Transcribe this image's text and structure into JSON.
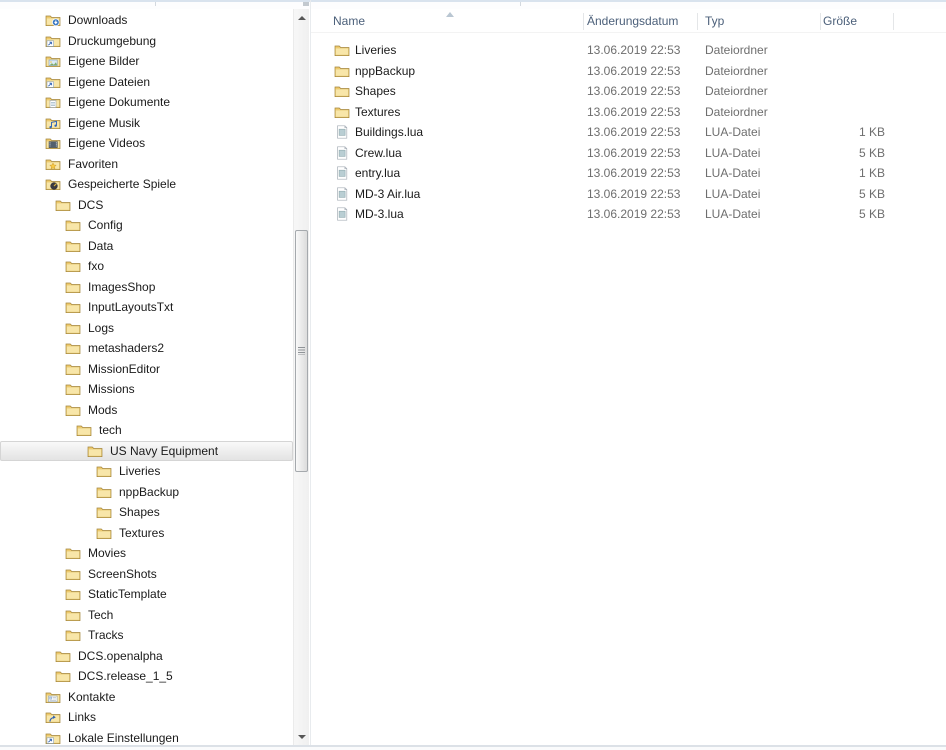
{
  "colors": {
    "selection_gradient_top": "#f9f9f9",
    "selection_gradient_bottom": "#e3e3e3",
    "selection_border": "#d5d5d5",
    "folder_yellow": "#efca6d",
    "header_text": "#4c607a",
    "secondary_text": "#6e6e6e",
    "primary_text": "#1a1a1a"
  },
  "tree_panel": {
    "scrollbar": {
      "visible": true
    },
    "items": [
      {
        "label": "Downloads",
        "level": 0,
        "icon": "folder-download-icon",
        "selected": false
      },
      {
        "label": "Druckumgebung",
        "level": 0,
        "icon": "folder-shortcut-icon",
        "selected": false
      },
      {
        "label": "Eigene Bilder",
        "level": 0,
        "icon": "folder-pictures-icon",
        "selected": false
      },
      {
        "label": "Eigene Dateien",
        "level": 0,
        "icon": "folder-shortcut-icon",
        "selected": false
      },
      {
        "label": "Eigene Dokumente",
        "level": 0,
        "icon": "folder-documents-icon",
        "selected": false
      },
      {
        "label": "Eigene Musik",
        "level": 0,
        "icon": "folder-music-icon",
        "selected": false
      },
      {
        "label": "Eigene Videos",
        "level": 0,
        "icon": "folder-videos-icon",
        "selected": false
      },
      {
        "label": "Favoriten",
        "level": 0,
        "icon": "folder-favorites-icon",
        "selected": false
      },
      {
        "label": "Gespeicherte Spiele",
        "level": 0,
        "icon": "folder-savedgames-icon",
        "selected": false
      },
      {
        "label": "DCS",
        "level": 1,
        "icon": "folder-icon",
        "selected": false
      },
      {
        "label": "Config",
        "level": 2,
        "icon": "folder-icon",
        "selected": false
      },
      {
        "label": "Data",
        "level": 2,
        "icon": "folder-icon",
        "selected": false
      },
      {
        "label": "fxo",
        "level": 2,
        "icon": "folder-icon",
        "selected": false
      },
      {
        "label": "ImagesShop",
        "level": 2,
        "icon": "folder-icon",
        "selected": false
      },
      {
        "label": "InputLayoutsTxt",
        "level": 2,
        "icon": "folder-icon",
        "selected": false
      },
      {
        "label": "Logs",
        "level": 2,
        "icon": "folder-icon",
        "selected": false
      },
      {
        "label": "metashaders2",
        "level": 2,
        "icon": "folder-icon",
        "selected": false
      },
      {
        "label": "MissionEditor",
        "level": 2,
        "icon": "folder-icon",
        "selected": false
      },
      {
        "label": "Missions",
        "level": 2,
        "icon": "folder-icon",
        "selected": false
      },
      {
        "label": "Mods",
        "level": 2,
        "icon": "folder-icon",
        "selected": false
      },
      {
        "label": "tech",
        "level": 3,
        "icon": "folder-icon",
        "selected": false
      },
      {
        "label": "US Navy Equipment",
        "level": 4,
        "icon": "folder-icon",
        "selected": true
      },
      {
        "label": "Liveries",
        "level": 5,
        "icon": "folder-icon",
        "selected": false
      },
      {
        "label": "nppBackup",
        "level": 5,
        "icon": "folder-icon",
        "selected": false
      },
      {
        "label": "Shapes",
        "level": 5,
        "icon": "folder-icon",
        "selected": false
      },
      {
        "label": "Textures",
        "level": 5,
        "icon": "folder-icon",
        "selected": false
      },
      {
        "label": "Movies",
        "level": 2,
        "icon": "folder-icon",
        "selected": false
      },
      {
        "label": "ScreenShots",
        "level": 2,
        "icon": "folder-icon",
        "selected": false
      },
      {
        "label": "StaticTemplate",
        "level": 2,
        "icon": "folder-icon",
        "selected": false
      },
      {
        "label": "Tech",
        "level": 2,
        "icon": "folder-icon",
        "selected": false
      },
      {
        "label": "Tracks",
        "level": 2,
        "icon": "folder-icon",
        "selected": false
      },
      {
        "label": "DCS.openalpha",
        "level": 1,
        "icon": "folder-icon",
        "selected": false
      },
      {
        "label": "DCS.release_1_5",
        "level": 1,
        "icon": "folder-icon",
        "selected": false
      },
      {
        "label": "Kontakte",
        "level": 0,
        "icon": "folder-contacts-icon",
        "selected": false
      },
      {
        "label": "Links",
        "level": 0,
        "icon": "folder-links-icon",
        "selected": false
      },
      {
        "label": "Lokale Einstellungen",
        "level": 0,
        "icon": "folder-shortcut-icon",
        "selected": false
      }
    ]
  },
  "file_panel": {
    "columns": [
      {
        "id": "name",
        "label": "Name"
      },
      {
        "id": "date",
        "label": "Änderungsdatum"
      },
      {
        "id": "type",
        "label": "Typ"
      },
      {
        "id": "size",
        "label": "Größe"
      }
    ],
    "sort": {
      "column": "Name",
      "direction": "ascending"
    },
    "rows": [
      {
        "name": "Liveries",
        "icon": "folder-icon",
        "date": "13.06.2019 22:53",
        "type": "Dateiordner",
        "size": ""
      },
      {
        "name": "nppBackup",
        "icon": "folder-icon",
        "date": "13.06.2019 22:53",
        "type": "Dateiordner",
        "size": ""
      },
      {
        "name": "Shapes",
        "icon": "folder-icon",
        "date": "13.06.2019 22:53",
        "type": "Dateiordner",
        "size": ""
      },
      {
        "name": "Textures",
        "icon": "folder-icon",
        "date": "13.06.2019 22:53",
        "type": "Dateiordner",
        "size": ""
      },
      {
        "name": "Buildings.lua",
        "icon": "lua-file-icon",
        "date": "13.06.2019 22:53",
        "type": "LUA-Datei",
        "size": "1 KB"
      },
      {
        "name": "Crew.lua",
        "icon": "lua-file-icon",
        "date": "13.06.2019 22:53",
        "type": "LUA-Datei",
        "size": "5 KB"
      },
      {
        "name": "entry.lua",
        "icon": "lua-file-icon",
        "date": "13.06.2019 22:53",
        "type": "LUA-Datei",
        "size": "1 KB"
      },
      {
        "name": "MD-3 Air.lua",
        "icon": "lua-file-icon",
        "date": "13.06.2019 22:53",
        "type": "LUA-Datei",
        "size": "5 KB"
      },
      {
        "name": "MD-3.lua",
        "icon": "lua-file-icon",
        "date": "13.06.2019 22:53",
        "type": "LUA-Datei",
        "size": "5 KB"
      }
    ]
  }
}
